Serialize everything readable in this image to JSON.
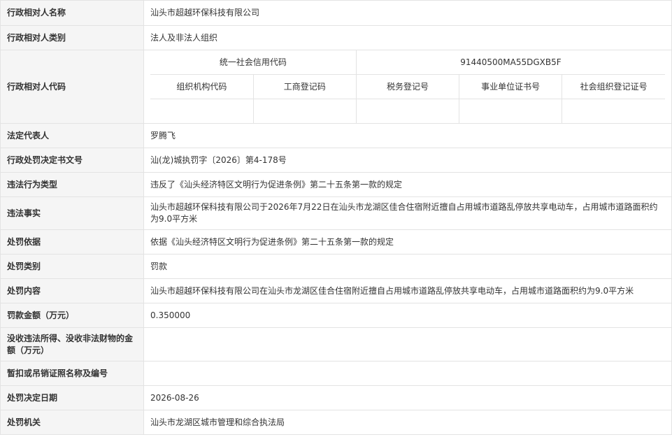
{
  "rows": {
    "name": {
      "label": "行政相对人名称",
      "value": "汕头市超越环保科技有限公司"
    },
    "category": {
      "label": "行政相对人类别",
      "value": "法人及非法人组织"
    },
    "code": {
      "label": "行政相对人代码",
      "credit_code_label": "统一社会信用代码",
      "credit_code_value": "91440500MA55DGXB5F",
      "org_code_label": "组织机构代码",
      "business_reg_label": "工商登记码",
      "tax_reg_label": "税务登记号",
      "institution_cert_label": "事业单位证书号",
      "social_org_label": "社会组织登记证号"
    },
    "legal_rep": {
      "label": "法定代表人",
      "value": "罗腾飞"
    },
    "decision_no": {
      "label": "行政处罚决定书文号",
      "value": "汕(龙)城执罚字〔2026〕第4-178号"
    },
    "violation_type": {
      "label": "违法行为类型",
      "value": "违反了《汕头经济特区文明行为促进条例》第二十五条第一款的规定"
    },
    "violation_fact": {
      "label": "违法事实",
      "value": "汕头市超越环保科技有限公司于2026年7月22日在汕头市龙湖区佳合住宿附近擅自占用城市道路乱停放共享电动车，占用城市道路面积约为9.0平方米"
    },
    "basis": {
      "label": "处罚依据",
      "value": "依据《汕头经济特区文明行为促进条例》第二十五条第一款的规定"
    },
    "penalty_type": {
      "label": "处罚类别",
      "value": "罚款"
    },
    "penalty_content": {
      "label": "处罚内容",
      "value": "汕头市超越环保科技有限公司在汕头市龙湖区佳合住宿附近擅自占用城市道路乱停放共享电动车，占用城市道路面积约为9.0平方米"
    },
    "fine_amount": {
      "label": "罚款金额（万元）",
      "value": "0.350000"
    },
    "confiscation": {
      "label": "没收违法所得、没收非法财物的金额（万元）",
      "value": ""
    },
    "license_suspend": {
      "label": "暂扣或吊销证照名称及编号",
      "value": ""
    },
    "decision_date": {
      "label": "处罚决定日期",
      "value": "2026-08-26"
    },
    "authority": {
      "label": "处罚机关",
      "value": "汕头市龙湖区城市管理和综合执法局"
    }
  }
}
